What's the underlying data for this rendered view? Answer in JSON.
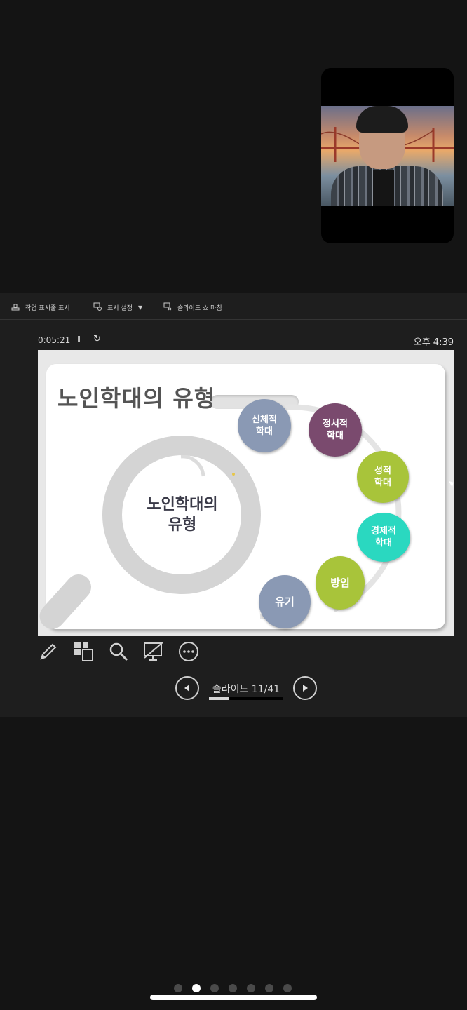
{
  "toolbar": {
    "taskbar_label": "작업 표시줄 표시",
    "display_settings_label": "표시 설정",
    "display_settings_caret": "▼",
    "end_slideshow_label": "슬라이드 쇼 마침"
  },
  "status": {
    "timer": "0:05:21",
    "pause_glyph": "II",
    "restart_glyph": "↻",
    "clock": "오후 4:39"
  },
  "slide": {
    "title": "노인학대의 유형",
    "center_text_line1": "노인학대의",
    "center_text_line2": "유형",
    "bubbles": [
      {
        "line1": "신체적",
        "line2": "학대",
        "color": "#8a99b4"
      },
      {
        "line1": "정서적",
        "line2": "학대",
        "color": "#7a4a6e"
      },
      {
        "line1": "성적",
        "line2": "학대",
        "color": "#a8c43a"
      },
      {
        "line1": "경제적",
        "line2": "학대",
        "color": "#2ad8c0"
      },
      {
        "line1": "방임",
        "line2": "",
        "color": "#a8c43a"
      },
      {
        "line1": "유기",
        "line2": "",
        "color": "#8a99b4"
      }
    ]
  },
  "tools": [
    "pen-icon",
    "layout-icon",
    "zoom-icon",
    "black-screen-icon",
    "more-icon"
  ],
  "navigation": {
    "slide_label": "슬라이드 11/41",
    "progress": 0.268
  },
  "pager": {
    "count": 7,
    "active_index": 1
  }
}
